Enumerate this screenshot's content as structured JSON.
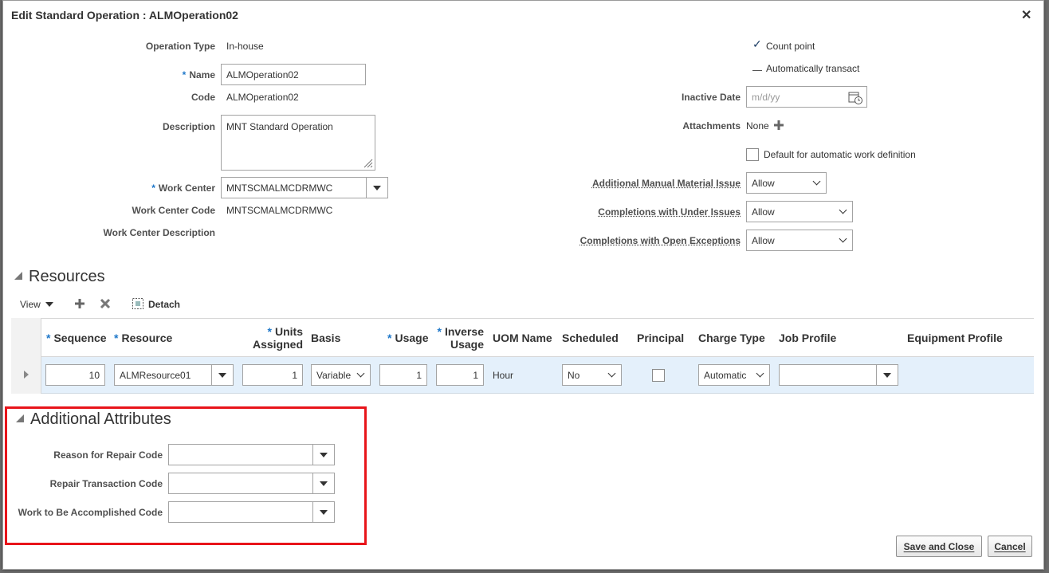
{
  "dialog": {
    "title": "Edit Standard Operation : ALMOperation02",
    "close_symbol": "✕"
  },
  "form": {
    "operation_type_label": "Operation Type",
    "operation_type_value": "In-house",
    "required_mark": "*",
    "name_label": "Name",
    "name_value": "ALMOperation02",
    "code_label": "Code",
    "code_value": "ALMOperation02",
    "description_label": "Description",
    "description_value": "MNT Standard Operation",
    "work_center_label": "Work Center",
    "work_center_value": "MNTSCMALMCDRMWC",
    "work_center_code_label": "Work Center Code",
    "work_center_code_value": "MNTSCMALMCDRMWC",
    "work_center_desc_label": "Work Center Description",
    "count_point_label": "Count point",
    "count_point_checked": true,
    "auto_transact_label": "Automatically transact",
    "auto_transact_checked": false,
    "inactive_date_label": "Inactive Date",
    "inactive_date_placeholder": "m/d/yy",
    "attachments_label": "Attachments",
    "attachments_value": "None",
    "default_auto_wd_label": "Default for automatic work definition",
    "add_manual_issue_label": "Additional Manual Material Issue",
    "add_manual_issue_value": "Allow",
    "completions_under_label": "Completions with Under Issues",
    "completions_under_value": "Allow",
    "completions_open_label": "Completions with Open Exceptions",
    "completions_open_value": "Allow"
  },
  "resources": {
    "title": "Resources",
    "toolbar": {
      "view_label": "View",
      "detach_label": "Detach"
    },
    "columns": {
      "sequence": "Sequence",
      "resource": "Resource",
      "units_1": "Units",
      "units_2": "Assigned",
      "basis": "Basis",
      "usage": "Usage",
      "inverse_1": "Inverse",
      "inverse_2": "Usage",
      "uom": "UOM Name",
      "scheduled": "Scheduled",
      "principal": "Principal",
      "charge_type": "Charge Type",
      "job_profile": "Job Profile",
      "equipment_profile": "Equipment Profile"
    },
    "row": {
      "sequence": "10",
      "resource": "ALMResource01",
      "units": "1",
      "basis": "Variable",
      "usage": "1",
      "inverse_usage": "1",
      "uom": "Hour",
      "scheduled": "No",
      "principal": false,
      "charge_type": "Automatic",
      "job_profile": ""
    }
  },
  "additional": {
    "title": "Additional Attributes",
    "reason_label": "Reason for Repair Code",
    "repair_txn_label": "Repair Transaction Code",
    "work_accomplished_label": "Work to Be Accomplished Code"
  },
  "buttons": {
    "save_close": "Save and Close",
    "cancel": "Cancel"
  },
  "colors": {
    "required": "#1e77c9",
    "row_highlight": "#e4f0fb",
    "annotation_box": "#e8141a"
  }
}
